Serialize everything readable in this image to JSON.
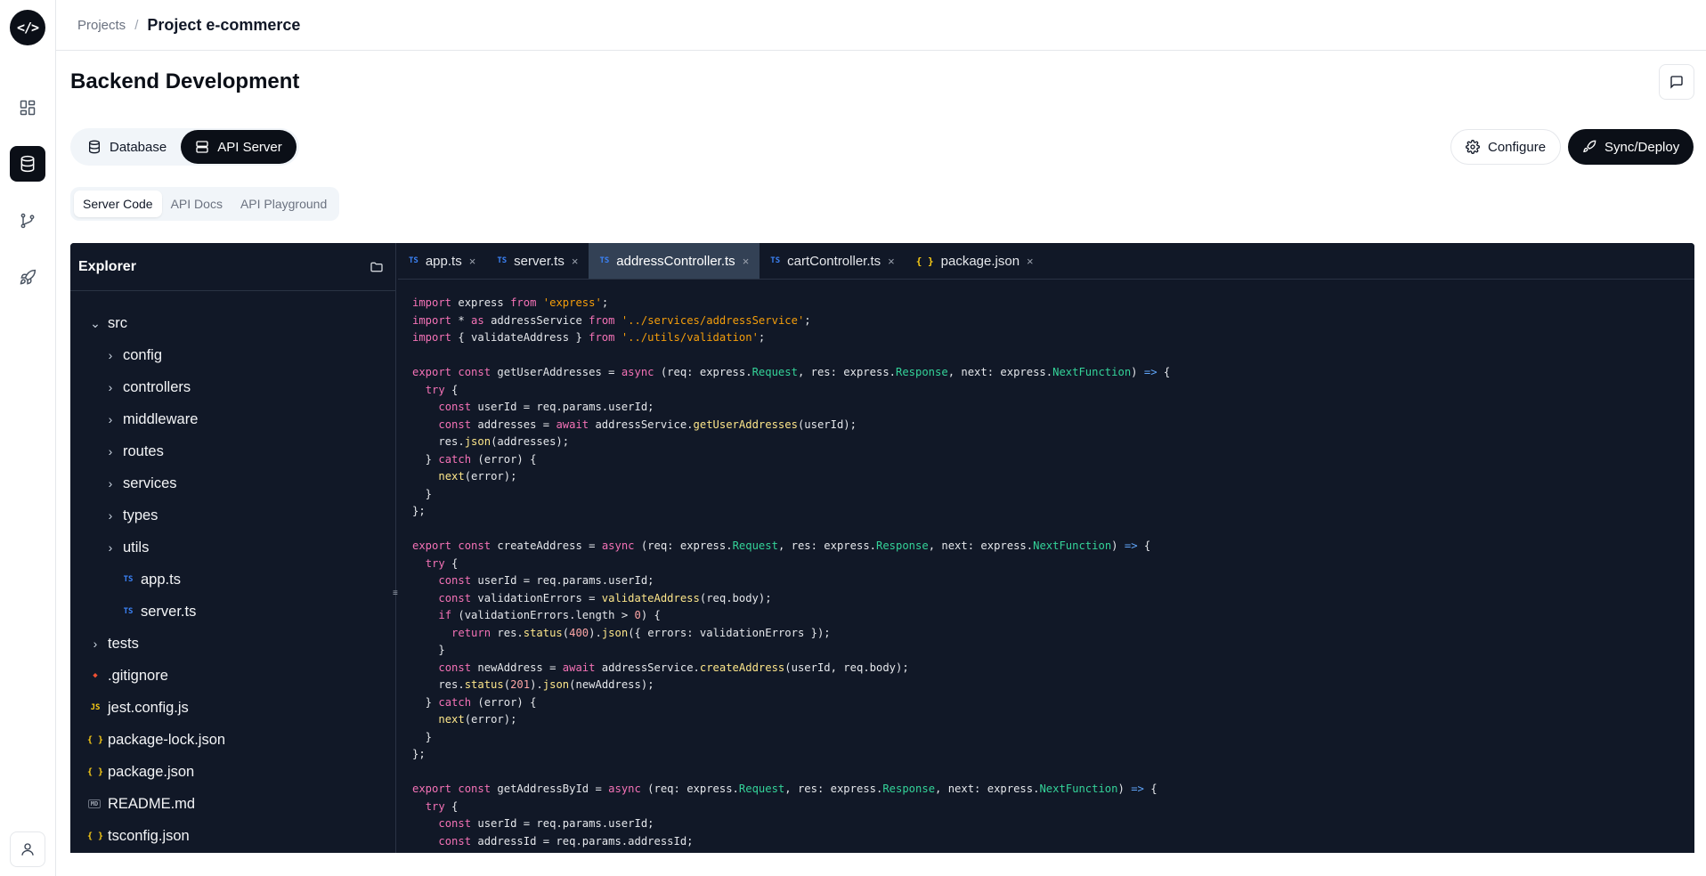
{
  "app": {
    "logo_text": "</>"
  },
  "rail": {
    "items": [
      {
        "icon": "dashboard-icon",
        "active": false
      },
      {
        "icon": "database-icon",
        "active": true
      },
      {
        "icon": "git-branch-icon",
        "active": false
      },
      {
        "icon": "rocket-icon",
        "active": false
      }
    ],
    "user_icon": "user-icon"
  },
  "breadcrumb": {
    "parent": "Projects",
    "separator": "/",
    "current": "Project e-commerce"
  },
  "page": {
    "title": "Backend Development"
  },
  "segments": {
    "database_label": "Database",
    "api_server_label": "API Server",
    "active": "API Server"
  },
  "actions": {
    "configure_label": "Configure",
    "deploy_label": "Sync/Deploy"
  },
  "subtabs": {
    "items": [
      "Server Code",
      "API Docs",
      "API Playground"
    ],
    "active": "Server Code"
  },
  "explorer": {
    "title": "Explorer",
    "tree": [
      {
        "name": "src",
        "type": "folder",
        "open": true,
        "depth": 0
      },
      {
        "name": "config",
        "type": "folder",
        "open": false,
        "depth": 1
      },
      {
        "name": "controllers",
        "type": "folder",
        "open": false,
        "depth": 1
      },
      {
        "name": "middleware",
        "type": "folder",
        "open": false,
        "depth": 1
      },
      {
        "name": "routes",
        "type": "folder",
        "open": false,
        "depth": 1
      },
      {
        "name": "services",
        "type": "folder",
        "open": false,
        "depth": 1
      },
      {
        "name": "types",
        "type": "folder",
        "open": false,
        "depth": 1
      },
      {
        "name": "utils",
        "type": "folder",
        "open": false,
        "depth": 1
      },
      {
        "name": "app.ts",
        "type": "ts",
        "depth": 2
      },
      {
        "name": "server.ts",
        "type": "ts",
        "depth": 2
      },
      {
        "name": "tests",
        "type": "folder",
        "open": false,
        "depth": 0
      },
      {
        "name": ".gitignore",
        "type": "git",
        "depth": 0
      },
      {
        "name": "jest.config.js",
        "type": "js",
        "depth": 0
      },
      {
        "name": "package-lock.json",
        "type": "json",
        "depth": 0
      },
      {
        "name": "package.json",
        "type": "json",
        "depth": 0
      },
      {
        "name": "README.md",
        "type": "md",
        "depth": 0
      },
      {
        "name": "tsconfig.json",
        "type": "json",
        "depth": 0
      }
    ]
  },
  "editor": {
    "tabs": [
      {
        "name": "app.ts",
        "type": "ts",
        "active": false
      },
      {
        "name": "server.ts",
        "type": "ts",
        "active": false
      },
      {
        "name": "addressController.ts",
        "type": "ts",
        "active": true
      },
      {
        "name": "cartController.ts",
        "type": "ts",
        "active": false
      },
      {
        "name": "package.json",
        "type": "json",
        "active": false
      }
    ],
    "code_lines": [
      "import express from 'express';",
      "import * as addressService from '../services/addressService';",
      "import { validateAddress } from '../utils/validation';",
      "",
      "export const getUserAddresses = async (req: express.Request, res: express.Response, next: express.NextFunction) => {",
      "  try {",
      "    const userId = req.params.userId;",
      "    const addresses = await addressService.getUserAddresses(userId);",
      "    res.json(addresses);",
      "  } catch (error) {",
      "    next(error);",
      "  }",
      "};",
      "",
      "export const createAddress = async (req: express.Request, res: express.Response, next: express.NextFunction) => {",
      "  try {",
      "    const userId = req.params.userId;",
      "    const validationErrors = validateAddress(req.body);",
      "    if (validationErrors.length > 0) {",
      "      return res.status(400).json({ errors: validationErrors });",
      "    }",
      "    const newAddress = await addressService.createAddress(userId, req.body);",
      "    res.status(201).json(newAddress);",
      "  } catch (error) {",
      "    next(error);",
      "  }",
      "};",
      "",
      "export const getAddressById = async (req: express.Request, res: express.Response, next: express.NextFunction) => {",
      "  try {",
      "    const userId = req.params.userId;",
      "    const addressId = req.params.addressId;"
    ]
  },
  "colors": {
    "primary": "#0b0f17",
    "editor_bg": "#111827",
    "active_tab_bg": "#334155",
    "keyword": "#f472b6",
    "string": "#f59e0b",
    "function": "#fde68a",
    "type": "#34d399"
  }
}
